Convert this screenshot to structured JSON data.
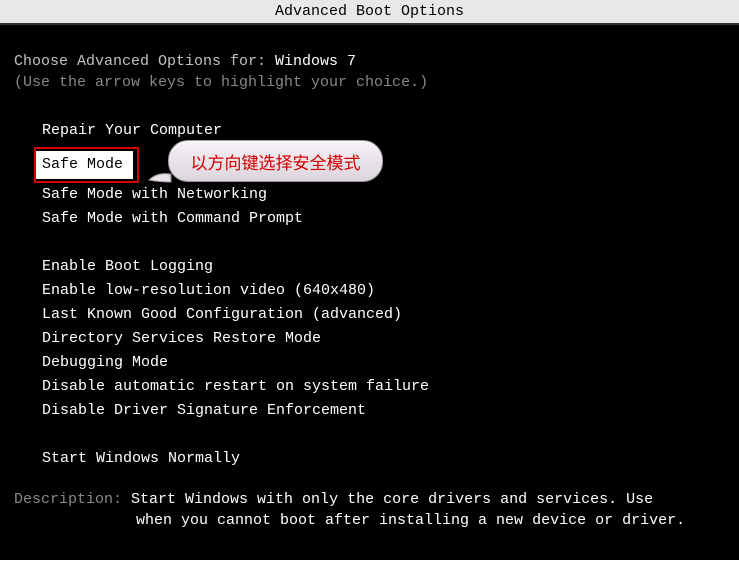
{
  "title": "Advanced Boot Options",
  "header": {
    "prefix": "Choose Advanced Options for: ",
    "os_name": "Windows 7"
  },
  "hint": "(Use the arrow keys to highlight your choice.)",
  "options": {
    "repair": "Repair Your Computer",
    "safe_mode": "Safe Mode",
    "safe_mode_net": "Safe Mode with Networking",
    "safe_mode_cmd": "Safe Mode with Command Prompt",
    "boot_logging": "Enable Boot Logging",
    "low_res": "Enable low-resolution video (640x480)",
    "last_known": "Last Known Good Configuration (advanced)",
    "ds_restore": "Directory Services Restore Mode",
    "debug": "Debugging Mode",
    "no_auto_restart": "Disable automatic restart on system failure",
    "no_driver_sig": "Disable Driver Signature Enforcement",
    "start_normal": "Start Windows Normally"
  },
  "description": {
    "label": "Description: ",
    "line1": "Start Windows with only the core drivers and services. Use",
    "line2": "when you cannot boot after installing a new device or driver."
  },
  "callout": {
    "text": "以方向键选择安全模式"
  }
}
